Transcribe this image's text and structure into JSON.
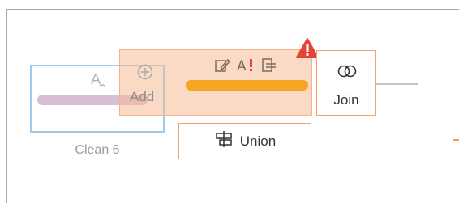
{
  "nodes": {
    "clean": {
      "label": "Clean 6",
      "icon": "clean-step-icon"
    },
    "add": {
      "label": "Add",
      "icon": "plus-circle-icon"
    },
    "join": {
      "label": "Join",
      "icon": "join-icon"
    },
    "union": {
      "label": "Union",
      "icon": "union-icon"
    }
  },
  "toolbar": {
    "icons": [
      "edit-icon",
      "clean-warning-icon",
      "output-icon"
    ],
    "warning": "warning-triangle-icon"
  },
  "colors": {
    "accent_orange": "#f6a623",
    "selection_blue": "#9dcbe9",
    "clean_bar": "#d8bfd3",
    "warning_red": "#e8433a",
    "node_border": "#f0a36a"
  }
}
